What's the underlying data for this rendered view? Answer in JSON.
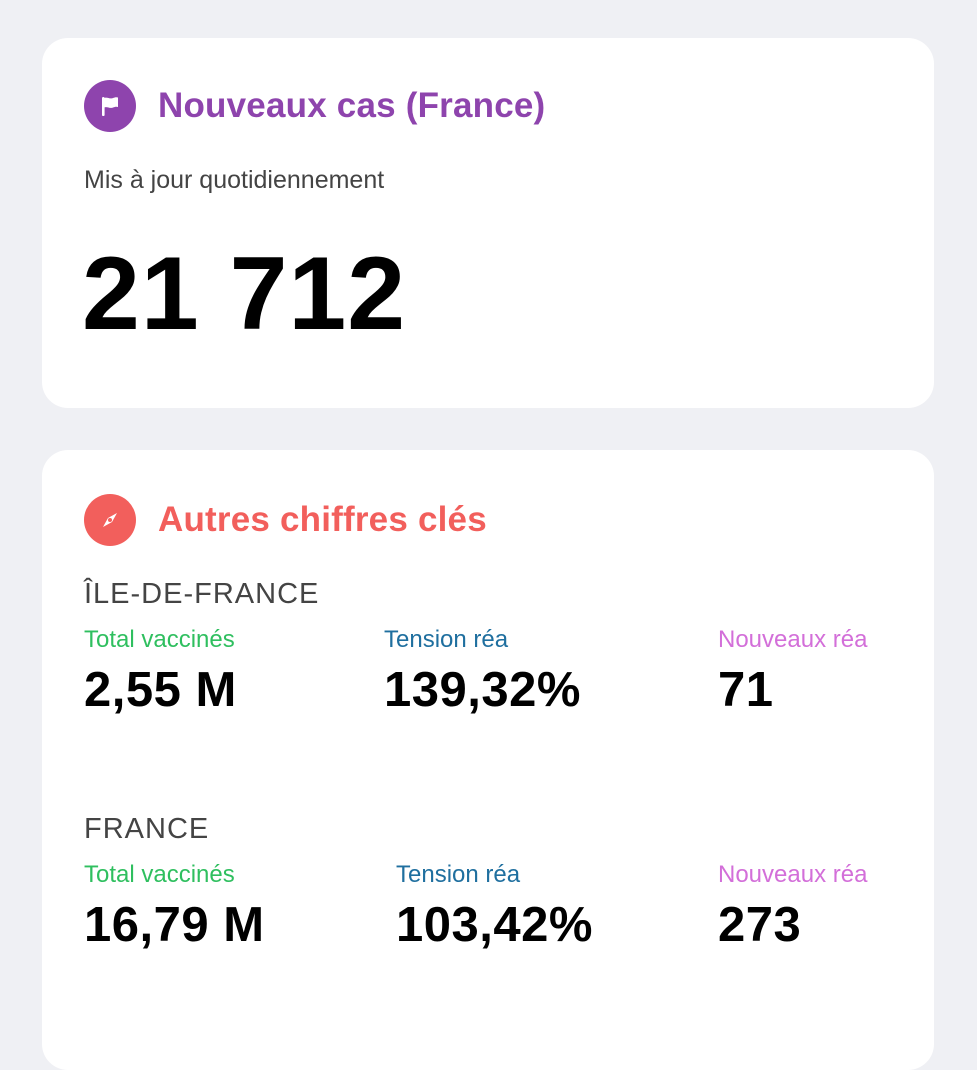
{
  "new_cases_card": {
    "title": "Nouveaux cas (France)",
    "subtitle": "Mis à jour quotidiennement",
    "value": "21 712",
    "icon": "flag-icon",
    "accent_color": "#8e44ad"
  },
  "other_figures_card": {
    "title": "Autres chiffres clés",
    "icon": "compass-icon",
    "accent_color": "#f25f5c",
    "regions": [
      {
        "name": "ÎLE-DE-FRANCE",
        "stats": [
          {
            "label": "Total vaccinés",
            "value": "2,55 M",
            "color": "#2fbf5f"
          },
          {
            "label": "Tension réa",
            "value": "139,32%",
            "color": "#1f6f9f"
          },
          {
            "label": "Nouveaux réa",
            "value": "71",
            "color": "#d36fd9"
          }
        ]
      },
      {
        "name": "FRANCE",
        "stats": [
          {
            "label": "Total vaccinés",
            "value": "16,79 M",
            "color": "#2fbf5f"
          },
          {
            "label": "Tension réa",
            "value": "103,42%",
            "color": "#1f6f9f"
          },
          {
            "label": "Nouveaux réa",
            "value": "273",
            "color": "#d36fd9"
          }
        ]
      }
    ]
  }
}
